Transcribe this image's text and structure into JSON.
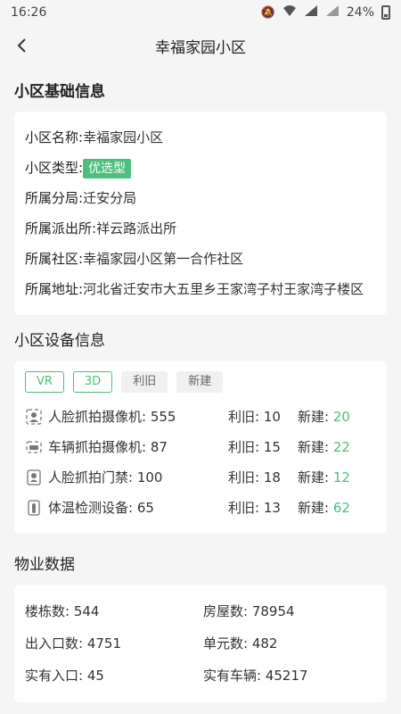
{
  "status": {
    "time": "16:26",
    "battery": "24%"
  },
  "nav": {
    "title": "幸福家园小区"
  },
  "basic": {
    "heading": "小区基础信息",
    "rows": [
      {
        "label": "小区名称:",
        "value": "幸福家园小区"
      },
      {
        "label": "小区类型:",
        "value": "优选型"
      },
      {
        "label": "所属分局:",
        "value": "迁安分局"
      },
      {
        "label": "所属派出所:",
        "value": "祥云路派出所"
      },
      {
        "label": "所属社区:",
        "value": "幸福家园小区第一合作社区"
      },
      {
        "label": "所属地址:",
        "value": "河北省迁安市大五里乡王家湾子村王家湾子楼区"
      }
    ]
  },
  "devices": {
    "heading": "小区设备信息",
    "chips": [
      "VR",
      "3D",
      "利旧",
      "新建"
    ],
    "old_label": "利旧:",
    "new_label": "新建:",
    "items": [
      {
        "name": "人脸抓拍摄像机:",
        "count": "555",
        "old": "10",
        "new": "20",
        "icon": "face-camera-icon"
      },
      {
        "name": "车辆抓拍摄像机:",
        "count": "87",
        "old": "15",
        "new": "22",
        "icon": "vehicle-camera-icon"
      },
      {
        "name": "人脸抓拍门禁:",
        "count": "100",
        "old": "18",
        "new": "12",
        "icon": "face-access-icon"
      },
      {
        "name": "体温检测设备:",
        "count": "65",
        "old": "13",
        "new": "62",
        "icon": "thermometer-device-icon"
      }
    ]
  },
  "property": {
    "heading": "物业数据",
    "items": [
      {
        "label": "楼栋数:",
        "value": "544"
      },
      {
        "label": "房屋数:",
        "value": "78954"
      },
      {
        "label": "出入口数:",
        "value": "4751"
      },
      {
        "label": "单元数:",
        "value": "482"
      },
      {
        "label": "实有入口:",
        "value": "45"
      },
      {
        "label": "实有车辆:",
        "value": "45217"
      }
    ]
  },
  "colors": {
    "accent": "#4CBF7A",
    "background": "#f5f5f5"
  }
}
